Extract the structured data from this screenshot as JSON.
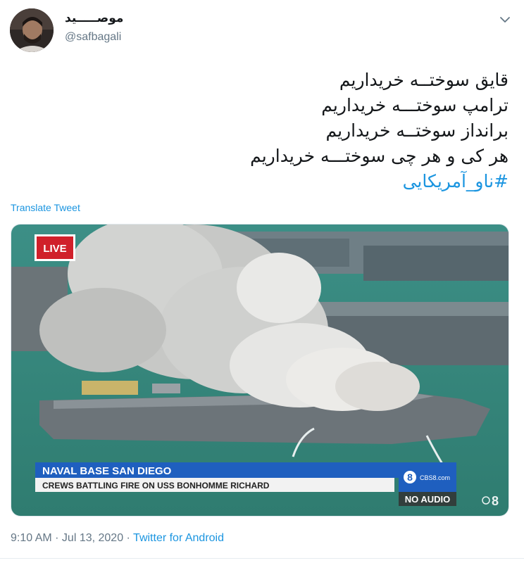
{
  "user": {
    "display_name": "موصـــــيد",
    "handle": "@safbagali"
  },
  "tweet": {
    "lines": [
      "قایق سوختــه خریداریم",
      "ترامپ سوختـــه خریداریم",
      "برانداز سوختــه خریداریم",
      "هر کی و هر چی سوختـــه خریداریم"
    ],
    "hashtag": "#ناو_آمریکایی",
    "translate_label": "Translate Tweet"
  },
  "media": {
    "live_badge": "LIVE",
    "headline": "NAVAL BASE SAN DIEGO",
    "subheadline": "CREWS BATTLING FIRE ON USS BONHOMME RICHARD",
    "channel_logo": "CBS8.com",
    "no_audio": "NO AUDIO",
    "watermark": "8"
  },
  "meta": {
    "time": "9:10 AM",
    "separator": " · ",
    "date": "Jul 13, 2020",
    "source": "Twitter for Android"
  },
  "colors": {
    "link": "#1b95e0",
    "secondary_text": "#657786",
    "live_red": "#d0202a",
    "banner_blue": "#1f5fbf"
  },
  "icons": {
    "menu": "chevron-down-icon"
  }
}
